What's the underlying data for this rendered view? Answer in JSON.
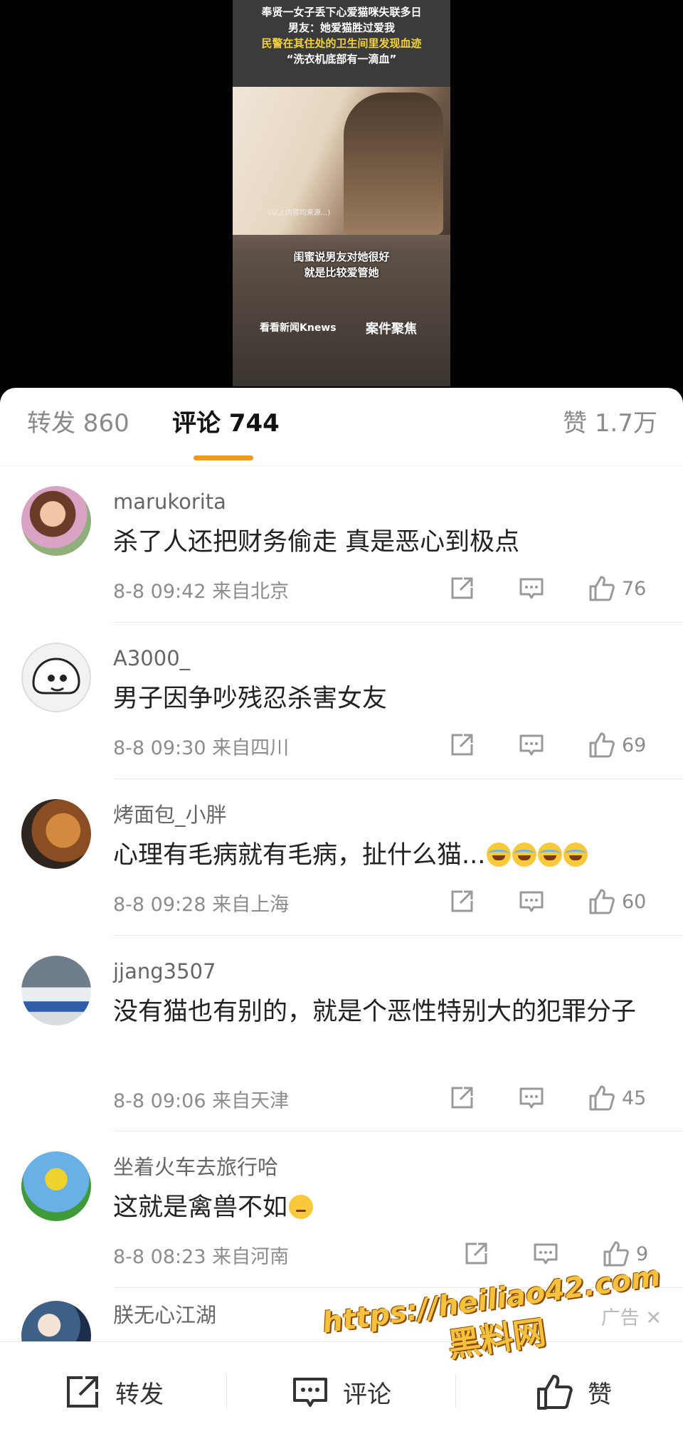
{
  "video": {
    "headlines": [
      "奉贤一女子丢下心爱猫咪失联多日",
      "男友：她爱猫胜过爱我",
      "民警在其住处的卫生间里发现血迹",
      "“洗衣机底部有一滴血”"
    ],
    "caption_line1": "闺蜜说男友对她很好",
    "caption_line2": "就是比较爱管她",
    "small_text": "(以上内容均来源...)",
    "logo": "看看新闻Knews",
    "logo2": "案件聚焦"
  },
  "tabs": {
    "forward": "转发 860",
    "comment": "评论 744",
    "like": "赞 1.7万"
  },
  "comments": [
    {
      "user": "marukorita",
      "text": "杀了人还把财务偷走 真是恶心到极点",
      "time": "8-8 09:42",
      "location": "来自北京",
      "likes": "76"
    },
    {
      "user": "A3000_",
      "text": "男子因争吵残忍杀害女友",
      "time": "8-8 09:30",
      "location": "来自四川",
      "likes": "69"
    },
    {
      "user": "烤面包_小胖",
      "text": "心理有毛病就有毛病，扯什么猫...",
      "time": "8-8 09:28",
      "location": "来自上海",
      "likes": "60"
    },
    {
      "user": "jjang3507",
      "text": "没有猫也有别的，就是个恶性特别大的犯罪分子",
      "time": "8-8 09:06",
      "location": "来自天津",
      "likes": "45"
    },
    {
      "user": "坐着火车去旅行哈",
      "text": "这就是禽兽不如",
      "time": "8-8 08:23",
      "location": "来自河南",
      "likes": "9"
    },
    {
      "user": "朕无心江湖",
      "ad_label": "广告"
    }
  ],
  "bottom_bar": {
    "forward": "转发",
    "comment": "评论",
    "like": "赞"
  },
  "watermark": {
    "url": "https://heiliao42.com",
    "name": "黑料网"
  },
  "colors": {
    "accent": "#f29a1d",
    "watermark": "#f6c23e"
  }
}
